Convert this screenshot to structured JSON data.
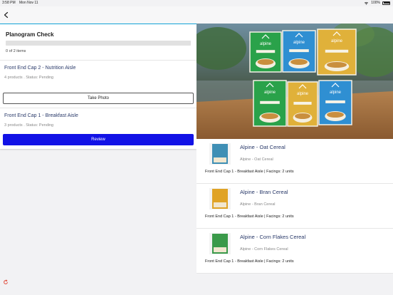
{
  "status": {
    "time": "3:58 PM",
    "date": "Mon Nov 11",
    "battery": "100%"
  },
  "checklist": {
    "title": "Planogram Check",
    "progress_text": "0 of 2 items",
    "progress_fraction": 0,
    "aisles": [
      {
        "name": "Front End Cap 2 - Nutrition Aisle",
        "meta": "4 products . Status: Pending",
        "action": "Take Photo"
      },
      {
        "name": "Front End Cap 1 - Breakfast Aisle",
        "meta": "3 products . Status: Pending",
        "action": "Review"
      }
    ]
  },
  "products": [
    {
      "name": "Alpine - Oat Cereal",
      "sub": "Alpine - Oat Cereal",
      "info": "Front End Cap 1 - Breakfast Aisle | Facings: 2 units",
      "color": "#3f8fb5"
    },
    {
      "name": "Alpine - Bran Cereal",
      "sub": "Alpine - Bran Cereal",
      "info": "Front End Cap 1 - Breakfast Aisle | Facings: 2 units",
      "color": "#e0a326"
    },
    {
      "name": "Alpine - Corn Flakes Cereal",
      "sub": "Alpine - Corn Flakes Cereal",
      "info": "Front End Cap 1 - Breakfast Aisle | Facings: 2 units",
      "color": "#3a9a4a"
    }
  ],
  "photo_boxes": {
    "brand": "alpine",
    "colors": [
      "#2aa24a",
      "#2f8fd2",
      "#e0b13a",
      "#2aa24a",
      "#e0b13a",
      "#2f8fd2"
    ]
  },
  "icons": {
    "back": "chevron-left-icon",
    "refresh": "refresh-icon",
    "wifi": "wifi-icon",
    "battery": "battery-icon"
  },
  "colors": {
    "accent": "#14a5d8",
    "primary_button": "#1212e6",
    "link_text": "#2a3a6a"
  }
}
